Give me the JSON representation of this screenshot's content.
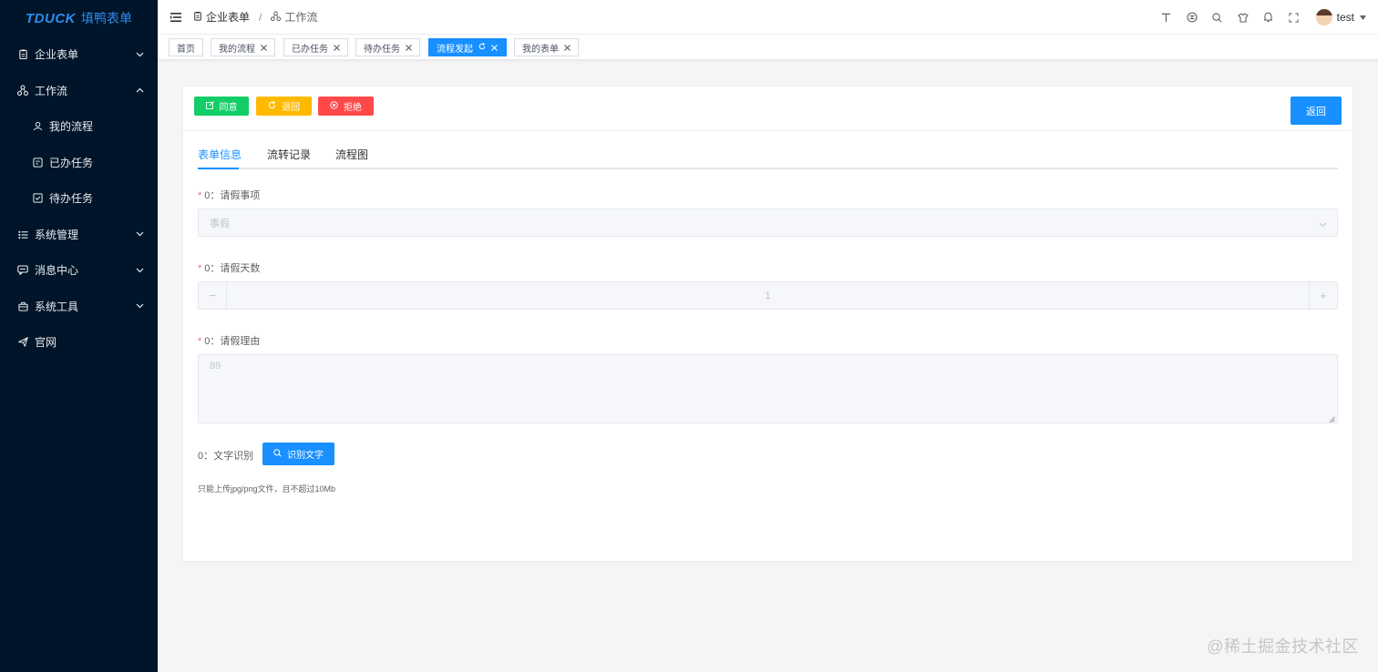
{
  "logo": {
    "brand": "TDUCK",
    "name": "填鸭表单"
  },
  "sidebar": {
    "items": [
      {
        "label": "企业表单",
        "icon": "clipboard-icon",
        "expandable": true
      },
      {
        "label": "工作流",
        "icon": "workflow-icon",
        "expandable": true,
        "expanded": true
      },
      {
        "label": "我的流程",
        "icon": "user-icon",
        "sub": true
      },
      {
        "label": "已办任务",
        "icon": "done-task-icon",
        "sub": true
      },
      {
        "label": "待办任务",
        "icon": "todo-task-icon",
        "sub": true
      },
      {
        "label": "系统管理",
        "icon": "list-icon",
        "expandable": true
      },
      {
        "label": "消息中心",
        "icon": "message-icon",
        "expandable": true
      },
      {
        "label": "系统工具",
        "icon": "toolbox-icon",
        "expandable": true
      },
      {
        "label": "官网",
        "icon": "send-icon",
        "expandable": false
      }
    ]
  },
  "header": {
    "breadcrumb": [
      {
        "label": "企业表单",
        "icon": "clipboard-icon"
      },
      {
        "label": "工作流",
        "icon": "workflow-icon"
      }
    ],
    "separator": "/",
    "right_icons": [
      "font-size-icon",
      "github-icon",
      "search-icon",
      "theme-icon",
      "bell-icon",
      "fullscreen-icon"
    ],
    "username": "test"
  },
  "tags": [
    {
      "label": "首页",
      "closable": false,
      "active": false
    },
    {
      "label": "我的流程",
      "closable": true,
      "active": false
    },
    {
      "label": "已办任务",
      "closable": true,
      "active": false
    },
    {
      "label": "待办任务",
      "closable": true,
      "active": false
    },
    {
      "label": "流程发起",
      "closable": true,
      "active": true
    },
    {
      "label": "我的表单",
      "closable": true,
      "active": false
    }
  ],
  "actions": {
    "agree": "同意",
    "back": "退回",
    "reject": "拒绝",
    "return": "返回",
    "colors": {
      "agree": "#13ce66",
      "back": "#ffba00",
      "reject": "#ff4949",
      "primary": "#1890ff"
    }
  },
  "tabs": [
    {
      "label": "表单信息",
      "active": true
    },
    {
      "label": "流转记录",
      "active": false
    },
    {
      "label": "流程图",
      "active": false
    }
  ],
  "form": {
    "leave_type": {
      "label": "0：请假事项",
      "required": true,
      "value": "事假"
    },
    "leave_days": {
      "label": "0：请假天数",
      "required": true,
      "value": "1",
      "minus": "−",
      "plus": "+"
    },
    "leave_reason": {
      "label": "0：请假理由",
      "required": true,
      "value": "89"
    },
    "ocr": {
      "label": "0：文字识别",
      "button": "识别文字",
      "hint": "只能上传jpg/png文件，且不超过10Mb"
    }
  },
  "watermark": "@稀土掘金技术社区"
}
